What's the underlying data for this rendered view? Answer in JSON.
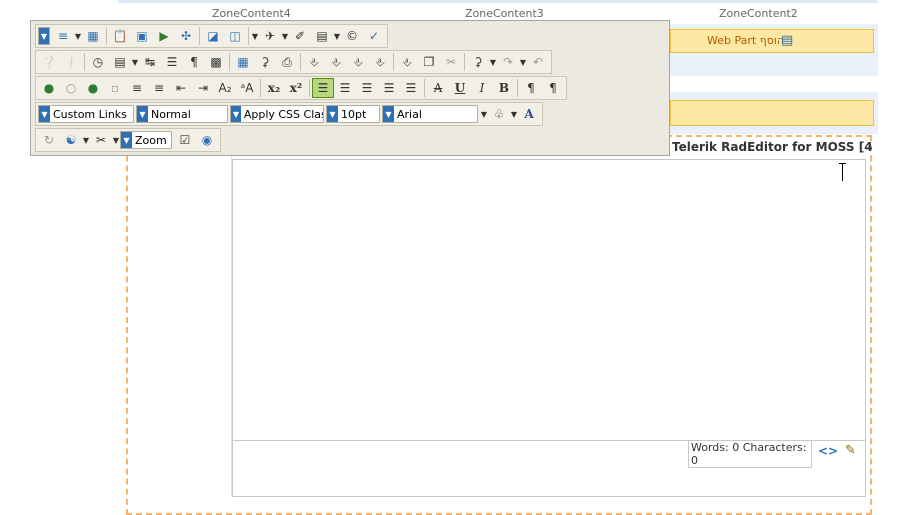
{
  "zones": {
    "zone4": "ZoneContent4",
    "zone3": "ZoneContent3",
    "zone2": "ZoneContent2"
  },
  "webpart_bar": {
    "label": "Web Part הוסף"
  },
  "editor": {
    "title": "Telerik RadEditor for MOSS [4",
    "word_count": "Words: 0 Characters: 0"
  },
  "toolbar": {
    "row4": {
      "custom_links": "Custom Links",
      "paragraph_style": "Normal",
      "css_class": "Apply CSS Class",
      "font_size": "10pt",
      "font_name": "Arial"
    },
    "row5": {
      "zoom": "Zoom"
    }
  },
  "colors": {
    "toolbar_bg": "#eceae0",
    "webpart_bar_bg": "#ffe8a3",
    "dashed_zone": "#f7b36a",
    "active_button": "#b8d880"
  }
}
